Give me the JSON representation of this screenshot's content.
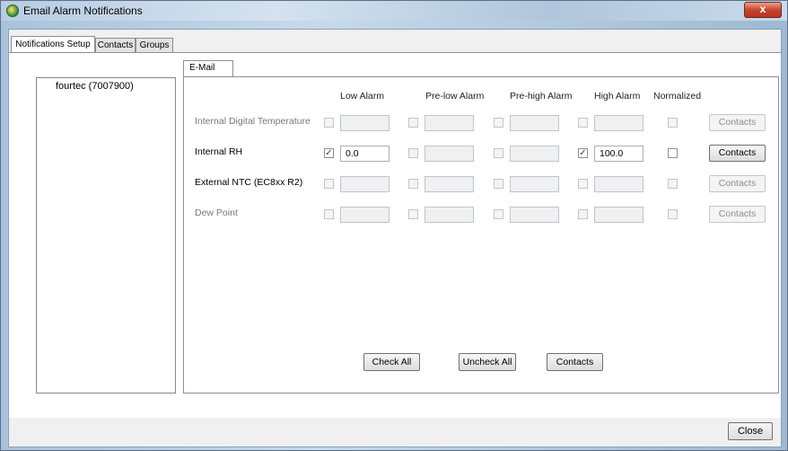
{
  "window": {
    "title": "Email Alarm Notifications",
    "close_glyph": "x"
  },
  "main_tabs": [
    "Notifications Setup",
    "Contacts",
    "Groups"
  ],
  "tree": {
    "items": [
      "fourtec (7007900)"
    ]
  },
  "email_tab": {
    "label": "E-Mail"
  },
  "columns": [
    "Low Alarm",
    "Pre-low Alarm",
    "Pre-high Alarm",
    "High Alarm",
    "Normalized"
  ],
  "rows": [
    {
      "label": "Internal Digital Temperature",
      "enabled": false,
      "cells": [
        {
          "checked": false,
          "value": ""
        },
        {
          "checked": false,
          "value": ""
        },
        {
          "checked": false,
          "value": ""
        },
        {
          "checked": false,
          "value": ""
        }
      ],
      "normalized": false,
      "contacts_label": "Contacts"
    },
    {
      "label": "Internal RH",
      "enabled": true,
      "cells": [
        {
          "checked": true,
          "value": "0.0"
        },
        {
          "checked": false,
          "value": ""
        },
        {
          "checked": false,
          "value": ""
        },
        {
          "checked": true,
          "value": "100.0"
        }
      ],
      "normalized": false,
      "contacts_label": "Contacts"
    },
    {
      "label": "External NTC (EC8xx R2)",
      "enabled": true,
      "cells": [
        {
          "checked": false,
          "value": ""
        },
        {
          "checked": false,
          "value": ""
        },
        {
          "checked": false,
          "value": ""
        },
        {
          "checked": false,
          "value": ""
        }
      ],
      "normalized": false,
      "contacts_label": "Contacts"
    },
    {
      "label": "Dew Point",
      "enabled": false,
      "cells": [
        {
          "checked": false,
          "value": ""
        },
        {
          "checked": false,
          "value": ""
        },
        {
          "checked": false,
          "value": ""
        },
        {
          "checked": false,
          "value": ""
        }
      ],
      "normalized": false,
      "contacts_label": "Contacts"
    }
  ],
  "actions": {
    "check_all": "Check All",
    "uncheck_all": "Uncheck All",
    "contacts": "Contacts"
  },
  "footer": {
    "close": "Close"
  },
  "colors": {
    "accent": "#2a3a8a",
    "disabled_text": "#8d8d8d"
  }
}
